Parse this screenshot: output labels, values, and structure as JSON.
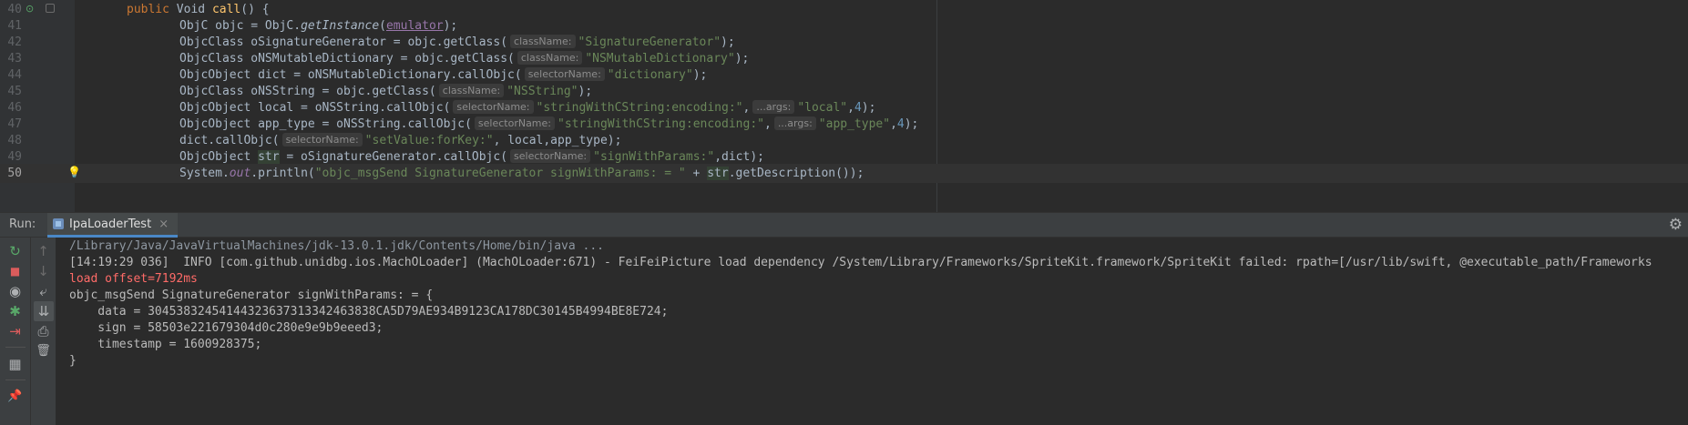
{
  "editor": {
    "line_numbers": [
      "40",
      "41",
      "42",
      "43",
      "44",
      "45",
      "46",
      "47",
      "48",
      "49",
      "50"
    ],
    "lines": {
      "l40": {
        "kw1": "public",
        "ty": "Void",
        "fn": "call",
        "rest": "() {"
      },
      "l41": {
        "a": "ObjC objc = ObjC.",
        "b": "getInstance",
        "c": "(",
        "d": "emulator",
        "e": ");"
      },
      "l42": {
        "a": "ObjcClass oSignatureGenerator = objc.getClass(",
        "hint": "className:",
        "s": "\"SignatureGenerator\"",
        "e": ");"
      },
      "l43": {
        "a": "ObjcClass oNSMutableDictionary = objc.getClass(",
        "hint": "className:",
        "s": "\"NSMutableDictionary\"",
        "e": ");"
      },
      "l44": {
        "a": "ObjcObject dict = oNSMutableDictionary.callObjc(",
        "hint": "selectorName:",
        "s": "\"dictionary\"",
        "e": ");"
      },
      "l45": {
        "a": "ObjcClass oNSString = objc.getClass(",
        "hint": "className:",
        "s": "\"NSString\"",
        "e": ");"
      },
      "l46": {
        "a": "ObjcObject local = oNSString.callObjc(",
        "hint": "selectorName:",
        "s": "\"stringWithCString:encoding:\"",
        "m": ",",
        "hint2": "...args:",
        "s2": "\"local\"",
        "m2": ",",
        "n": "4",
        "e": ");"
      },
      "l47": {
        "a": "ObjcObject app_type = oNSString.callObjc(",
        "hint": "selectorName:",
        "s": "\"stringWithCString:encoding:\"",
        "m": ",",
        "hint2": "...args:",
        "s2": "\"app_type\"",
        "m2": ",",
        "n": "4",
        "e": ");"
      },
      "l48": {
        "a": "dict.callObjc(",
        "hint": "selectorName:",
        "s": "\"setValue:forKey:\"",
        "e": ", local,app_type);"
      },
      "l49": {
        "a": "ObjcObject ",
        "v": "str",
        "b": " = oSignatureGenerator.callObjc(",
        "hint": "selectorName:",
        "s": "\"signWithParams:\"",
        "e": ",dict);"
      },
      "l50": {
        "a": "System.",
        "st": "out",
        "b": ".println(",
        "s": "\"objc_msgSend SignatureGenerator signWithParams: = \"",
        "c": " + ",
        "v": "str",
        "e": ".getDescription());"
      }
    }
  },
  "run_panel": {
    "label": "Run:",
    "tab_label": "IpaLoaderTest",
    "tab_close": "×"
  },
  "icons": {
    "rerun": "↻",
    "stop": "■",
    "camera": "◉",
    "bug": "✱",
    "exit": "⇥",
    "layout": "▦",
    "pin": "📌",
    "up": "↑",
    "down": "↓",
    "wrap": "⤶",
    "scroll": "⇊",
    "print": "⎙",
    "trash": "🗑",
    "settings": "⚙",
    "bulb": "💡",
    "override": "⊙"
  },
  "console": {
    "lines": [
      "/Library/Java/JavaVirtualMachines/jdk-13.0.1.jdk/Contents/Home/bin/java ...",
      "[14:19:29 036]  INFO [com.github.unidbg.ios.MachOLoader] (MachOLoader:671) - FeiFeiPicture load dependency /System/Library/Frameworks/SpriteKit.framework/SpriteKit failed: rpath=[/usr/lib/swift, @executable_path/Frameworks",
      "load offset=7192ms",
      "objc_msgSend SignatureGenerator signWithParams: = {",
      "    data = 30453832454144323637313342463838CA5D79AE934B9123CA178DC30145B4994BE8E724;",
      "    sign = 58503e221679304d0c280e9e9b9eeed3;",
      "    timestamp = 1600928375;",
      "}"
    ]
  },
  "colors": {
    "editor_bg": "#2b2b2b",
    "keyword": "#cc7832",
    "string": "#6a8759",
    "number": "#6897bb",
    "function": "#ffc66d",
    "error_text": "#ff6b68",
    "tab_underline": "#4a88c7"
  }
}
